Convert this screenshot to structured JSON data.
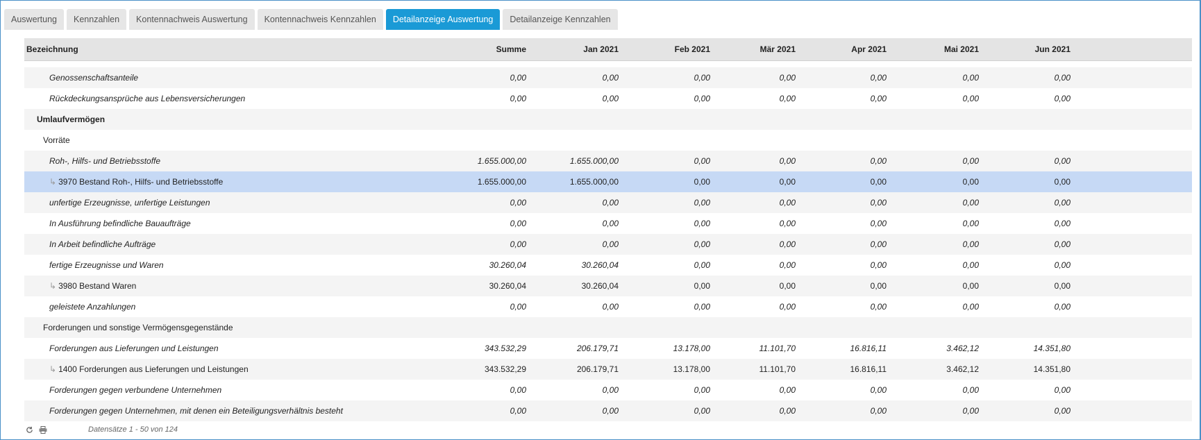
{
  "tabs": [
    {
      "label": "Auswertung",
      "active": false
    },
    {
      "label": "Kennzahlen",
      "active": false
    },
    {
      "label": "Kontennachweis Auswertung",
      "active": false
    },
    {
      "label": "Kontennachweis Kennzahlen",
      "active": false
    },
    {
      "label": "Detailanzeige Auswertung",
      "active": true
    },
    {
      "label": "Detailanzeige Kennzahlen",
      "active": false
    }
  ],
  "columns": [
    "Bezeichnung",
    "Summe",
    "Jan 2021",
    "Feb 2021",
    "Mär 2021",
    "Apr 2021",
    "Mai 2021",
    "Jun 2021"
  ],
  "rows": [
    {
      "label": "Genossenschaftsanteile",
      "level": 2,
      "style": "italic",
      "values": [
        "0,00",
        "0,00",
        "0,00",
        "0,00",
        "0,00",
        "0,00",
        "0,00"
      ]
    },
    {
      "label": "Rückdeckungsansprüche aus Lebensversicherungen",
      "level": 2,
      "style": "italic",
      "values": [
        "0,00",
        "0,00",
        "0,00",
        "0,00",
        "0,00",
        "0,00",
        "0,00"
      ]
    },
    {
      "label": "Umlaufvermögen",
      "level": 0,
      "style": "bold",
      "values": []
    },
    {
      "label": "Vorräte",
      "level": 1,
      "style": "normal",
      "values": []
    },
    {
      "label": "Roh-, Hilfs- und Betriebsstoffe",
      "level": 2,
      "style": "italic",
      "values": [
        "1.655.000,00",
        "1.655.000,00",
        "0,00",
        "0,00",
        "0,00",
        "0,00",
        "0,00"
      ]
    },
    {
      "label": "3970 Bestand Roh-, Hilfs- und Betriebsstoffe",
      "level": 2,
      "style": "account",
      "selected": true,
      "values": [
        "1.655.000,00",
        "1.655.000,00",
        "0,00",
        "0,00",
        "0,00",
        "0,00",
        "0,00"
      ]
    },
    {
      "label": "unfertige Erzeugnisse, unfertige Leistungen",
      "level": 2,
      "style": "italic",
      "values": [
        "0,00",
        "0,00",
        "0,00",
        "0,00",
        "0,00",
        "0,00",
        "0,00"
      ]
    },
    {
      "label": "In Ausführung befindliche Bauaufträge",
      "level": 2,
      "style": "italic",
      "values": [
        "0,00",
        "0,00",
        "0,00",
        "0,00",
        "0,00",
        "0,00",
        "0,00"
      ]
    },
    {
      "label": "In Arbeit befindliche Aufträge",
      "level": 2,
      "style": "italic",
      "values": [
        "0,00",
        "0,00",
        "0,00",
        "0,00",
        "0,00",
        "0,00",
        "0,00"
      ]
    },
    {
      "label": "fertige Erzeugnisse und Waren",
      "level": 2,
      "style": "italic",
      "values": [
        "30.260,04",
        "30.260,04",
        "0,00",
        "0,00",
        "0,00",
        "0,00",
        "0,00"
      ]
    },
    {
      "label": "3980 Bestand Waren",
      "level": 2,
      "style": "account",
      "values": [
        "30.260,04",
        "30.260,04",
        "0,00",
        "0,00",
        "0,00",
        "0,00",
        "0,00"
      ]
    },
    {
      "label": "geleistete Anzahlungen",
      "level": 2,
      "style": "italic",
      "values": [
        "0,00",
        "0,00",
        "0,00",
        "0,00",
        "0,00",
        "0,00",
        "0,00"
      ]
    },
    {
      "label": "Forderungen und sonstige Vermögensgegenstände",
      "level": 1,
      "style": "normal",
      "values": []
    },
    {
      "label": "Forderungen aus Lieferungen und Leistungen",
      "level": 2,
      "style": "italic",
      "values": [
        "343.532,29",
        "206.179,71",
        "13.178,00",
        "11.101,70",
        "16.816,11",
        "3.462,12",
        "14.351,80"
      ]
    },
    {
      "label": "1400 Forderungen aus Lieferungen und Leistungen",
      "level": 2,
      "style": "account",
      "values": [
        "343.532,29",
        "206.179,71",
        "13.178,00",
        "11.101,70",
        "16.816,11",
        "3.462,12",
        "14.351,80"
      ]
    },
    {
      "label": "Forderungen gegen verbundene Unternehmen",
      "level": 2,
      "style": "italic",
      "values": [
        "0,00",
        "0,00",
        "0,00",
        "0,00",
        "0,00",
        "0,00",
        "0,00"
      ]
    },
    {
      "label": "Forderungen gegen Unternehmen, mit denen ein Beteiligungsverhältnis besteht",
      "level": 2,
      "style": "italic",
      "values": [
        "0,00",
        "0,00",
        "0,00",
        "0,00",
        "0,00",
        "0,00",
        "0,00"
      ]
    }
  ],
  "footer": {
    "refresh_icon": "refresh-icon",
    "print_icon": "print-icon",
    "pager_text": "Datensätze 1 - 50 von 124"
  },
  "colors": {
    "active_tab": "#1a9ad6",
    "selected_row": "#c6d9f5",
    "frame": "#4a90c8"
  }
}
